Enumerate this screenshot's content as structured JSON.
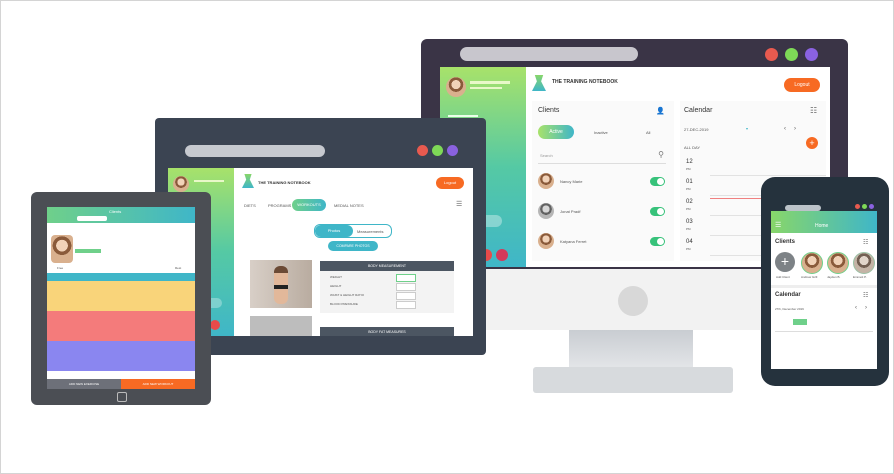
{
  "desktop": {
    "app_title": "THE TRAINING NOTEBOOK",
    "logout": "Logout",
    "clients_title": "Clients",
    "tabs": [
      "Active",
      "Inactive",
      "All"
    ],
    "search_placeholder": "Search",
    "clients": [
      "Nancy Marie",
      "Jonat Pradf",
      "Katyana Ferret"
    ],
    "calendar_title": "Calendar",
    "calendar_date": "27-DEC-2019",
    "all_day": "ALL DAY",
    "hours": [
      "12",
      "01",
      "02",
      "03",
      "04"
    ],
    "hour_suffix": "PM"
  },
  "laptop": {
    "app_title": "THE TRAINING NOTEBOOK",
    "logout": "Logout",
    "nav": [
      "DIETS",
      "PROGRAMS",
      "WORKOUTS",
      "MEDIAL NOTES"
    ],
    "segment": [
      "Photos",
      "Measurements"
    ],
    "action_btn": "COMPARE PHOTOS",
    "panel1_header": "BODY MEASUREMENT",
    "fields": [
      "WEIGHT",
      "HEIGHT",
      "WAIST & HEIGHT RATIO",
      "BLOOD PRESSURE"
    ],
    "panel2_header": "BODY FAT MEASURES"
  },
  "tablet": {
    "header": "Clients",
    "cols": [
      "Free",
      "Rest"
    ],
    "btn_left": "ADD NEW EXERCISE",
    "btn_right": "ADD NEW WORKOUT"
  },
  "phone": {
    "header": "Home",
    "clients_title": "Clients",
    "calendar_title": "Calendar",
    "add_label": "Add Client",
    "client_names": [
      "Andrew Grill",
      "Jayden B.",
      "Emmett P."
    ],
    "date": "27th, December 2019"
  },
  "colors": {
    "orange": "#f76a23",
    "green": "#37c27a",
    "teal": "#3fb6c8",
    "lime": "#a8e26a",
    "red_dot": "#e85a4f",
    "green_dot": "#7ed957",
    "purple_dot": "#8a62e0"
  }
}
